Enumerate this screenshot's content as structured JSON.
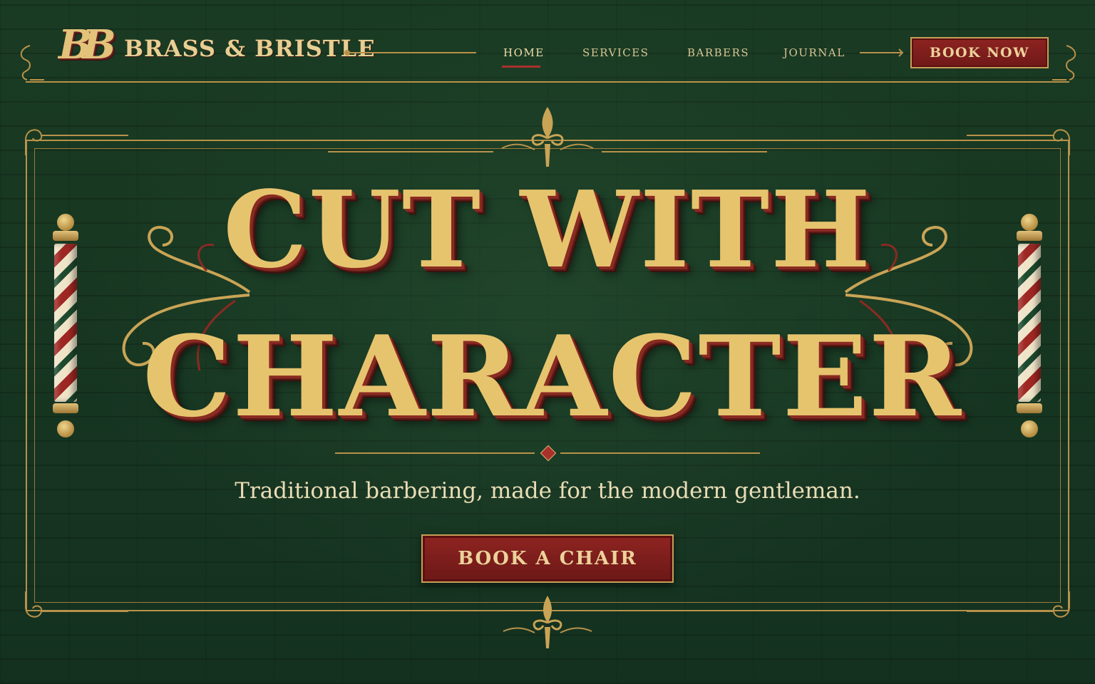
{
  "brand": {
    "monogram": "BB",
    "name": "BRASS & BRISTLE"
  },
  "nav": {
    "items": [
      {
        "label": "HOME",
        "active": true
      },
      {
        "label": "SERVICES",
        "active": false
      },
      {
        "label": "BARBERS",
        "active": false
      },
      {
        "label": "JOURNAL",
        "active": false
      }
    ],
    "cta": "BOOK NOW"
  },
  "hero": {
    "headline_line1": "CUT WITH",
    "headline_line2": "CHARACTER",
    "tagline": "Traditional barbering, made for the modern gentleman.",
    "cta": "BOOK A CHAIR"
  },
  "theme": {
    "background": "#17361f",
    "gold": "#d9bd76",
    "accent_red": "#8d2321"
  },
  "icons": {
    "pole_left": "barber-pole-icon",
    "pole_right": "barber-pole-icon",
    "top_ornament": "fleur-de-lis-icon",
    "bottom_ornament": "fleur-de-lis-icon"
  }
}
